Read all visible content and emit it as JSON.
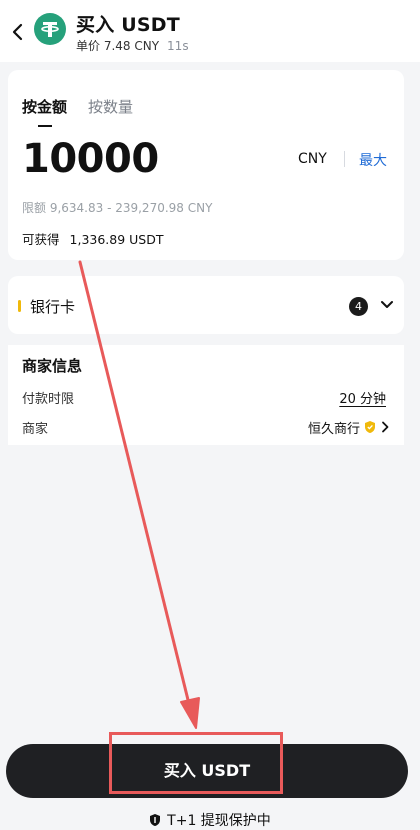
{
  "header": {
    "title": "买入 USDT",
    "unit_price": "单价 7.48 CNY",
    "timer": "11s",
    "logo_icon": "tether-logo-icon",
    "back_icon": "chevron-left-icon"
  },
  "order": {
    "tabs": [
      {
        "label": "按金额",
        "active": true
      },
      {
        "label": "按数量",
        "active": false
      }
    ],
    "amount": "10000",
    "currency": "CNY",
    "max_label": "最大",
    "limit_text": "限额 9,634.83 - 239,270.98 CNY",
    "obtain_label": "可获得",
    "obtain_value": "1,336.89 USDT"
  },
  "payment": {
    "method_label": "银行卡",
    "count": "4",
    "accent_color": "#f0b90b"
  },
  "merchant_info": {
    "title": "商家信息",
    "rows": [
      {
        "label": "付款时限",
        "value": "20 分钟"
      },
      {
        "label": "商家",
        "value": "恒久商行"
      }
    ]
  },
  "action": {
    "buy_label": "买入 USDT",
    "protection_text": "T+1 提现保护中"
  },
  "colors": {
    "brand_green": "#26a17b",
    "link_blue": "#1f6bd6",
    "button_dark": "#1f2023",
    "annotation_red": "#e85a5a"
  }
}
